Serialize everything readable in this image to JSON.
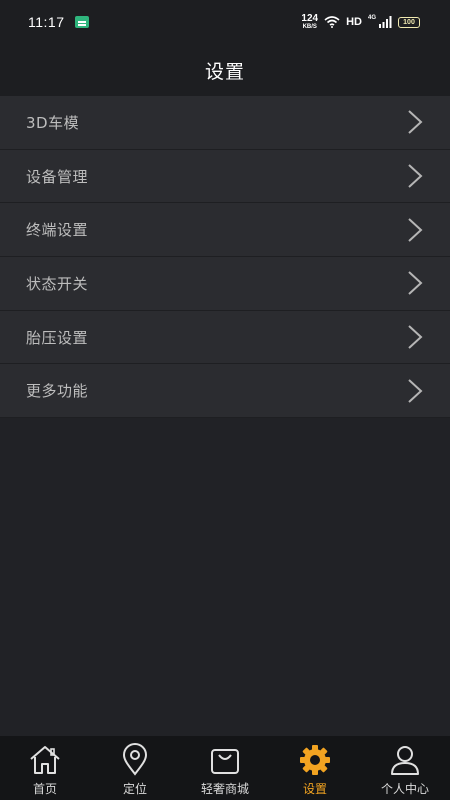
{
  "status_bar": {
    "time": "11:17",
    "net_speed_value": "124",
    "net_speed_unit": "KB/S",
    "hd": "HD",
    "signal_type": "4G",
    "battery": "100"
  },
  "header": {
    "title": "设置"
  },
  "menu": {
    "items": [
      {
        "label": "3D车模"
      },
      {
        "label": "设备管理"
      },
      {
        "label": "终端设置"
      },
      {
        "label": "状态开关"
      },
      {
        "label": "胎压设置"
      },
      {
        "label": "更多功能"
      }
    ]
  },
  "bottom_nav": {
    "items": [
      {
        "label": "首页",
        "icon": "home-icon"
      },
      {
        "label": "定位",
        "icon": "location-pin-icon"
      },
      {
        "label": "轻奢商城",
        "icon": "shopping-bag-icon"
      },
      {
        "label": "设置",
        "icon": "gear-icon",
        "active": true
      },
      {
        "label": "个人中心",
        "icon": "user-icon"
      }
    ]
  },
  "colors": {
    "background": "#212226",
    "menu_item": "#2b2c30",
    "accent": "#f2a321"
  }
}
